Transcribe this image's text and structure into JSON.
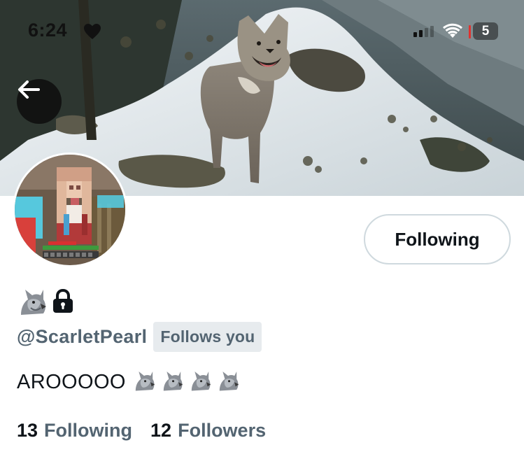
{
  "status_bar": {
    "time": "6:24",
    "battery": "5",
    "heart_icon": "heart-icon",
    "signal_icon": "cellular-signal-icon",
    "wifi_icon": "wifi-icon"
  },
  "header": {
    "back_icon": "back-arrow-icon",
    "banner_subject": "wolf on snowy hillside"
  },
  "profile": {
    "avatar_icon": "avatar-pixel-character",
    "name_emoji": [
      "wolf-icon",
      "lock-icon"
    ],
    "handle": "@ScarletPearl",
    "follows_you": "Follows you",
    "follow_button": "Following",
    "bio": "AROOOOO",
    "bio_emoji": [
      "wolf-icon",
      "wolf-icon",
      "wolf-icon",
      "wolf-icon"
    ],
    "following_count": "13",
    "following_label": "Following",
    "followers_count": "12",
    "followers_label": "Followers"
  },
  "colors": {
    "text_primary": "#0f1419",
    "text_secondary": "#536471",
    "button_border": "#cfd9de",
    "badge_bg": "#e7ebee"
  }
}
